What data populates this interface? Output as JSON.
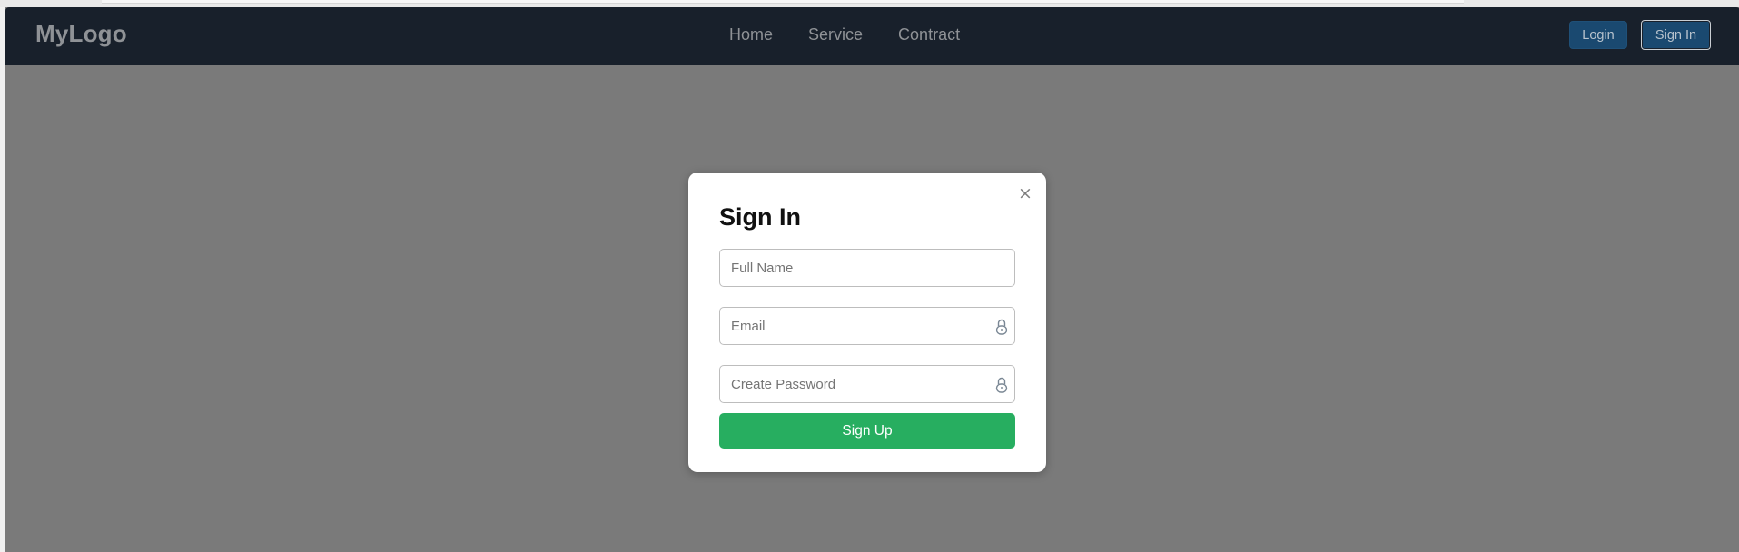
{
  "navbar": {
    "logo": "MyLogo",
    "links": [
      "Home",
      "Service",
      "Contract"
    ],
    "login_label": "Login",
    "signin_label": "Sign In"
  },
  "modal": {
    "close_glyph": "×",
    "title": "Sign In",
    "full_name_placeholder": "Full Name",
    "email_placeholder": "Email",
    "password_placeholder": "Create Password",
    "submit_label": "Sign Up"
  },
  "icons": {
    "close": "close-icon",
    "email_field": "lock-icon",
    "password_field": "lock-icon"
  },
  "colors": {
    "navbar_bg": "#18202b",
    "overlay": "#7a7a7a",
    "nav_button": "#1a4970",
    "submit_button": "#27ae60"
  }
}
